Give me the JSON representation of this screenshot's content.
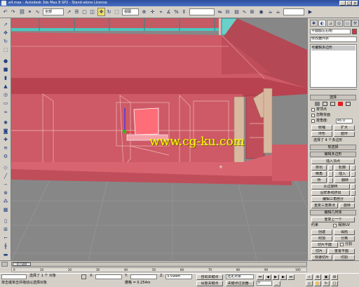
{
  "window": {
    "title": "a4.max - Autodesk 3ds Max 8 SP2 - Stand-alone License",
    "controls": [
      "_",
      "□",
      "×"
    ]
  },
  "toolbar": {
    "selection_filter": "全部",
    "reference_coord": "视图",
    "named_selection": "",
    "icons": [
      "undo-icon",
      "redo-icon",
      "select-link-icon",
      "unlink-icon",
      "bind-spacewarp-icon",
      "selection-filter",
      "select-object-icon",
      "select-by-name-icon",
      "rect-region-icon",
      "window-crossing-icon",
      "move-icon",
      "rotate-icon",
      "scale-icon",
      "ref-coord",
      "pivot-icon",
      "mirror-icon",
      "align-icon",
      "layer-icon",
      "curve-editor-icon",
      "schematic-icon",
      "material-editor-icon",
      "render-scene-icon",
      "quick-render-icon",
      "render-type"
    ]
  },
  "left_toolbar": {
    "icons": [
      "select-icon",
      "move-icon",
      "rotate-icon",
      "scale-icon",
      "sphere-icon",
      "box-icon",
      "cylinder-icon",
      "cone-icon",
      "torus-icon",
      "plane-icon",
      "teapot-icon",
      "light-icon",
      "camera-icon",
      "helper-icon",
      "spacewarp-icon",
      "systems-icon",
      "shape-icon",
      "line-icon",
      "nurbs-icon",
      "compound-icon",
      "particle-icon",
      "patch-icon",
      "door-icon",
      "window-icon",
      "stairs-icon",
      "railing-icon",
      "wall-icon"
    ]
  },
  "viewport": {
    "background": "#878787",
    "wall_color": "#cd5a66",
    "roof_color": "#c84a58",
    "wood_color": "#d7b8a0",
    "glass_color": "#5fc5c0",
    "watermark": "www.cg-ku.com"
  },
  "command_panel": {
    "object_name": "平面图左右组",
    "modifier_list": "修改器列表",
    "stack_item": "可编辑多边形",
    "rollout_selection": "选择",
    "check_by_vertex": "按顶点",
    "check_ignore_backface": "忽略背面",
    "angle_label": "按角度:",
    "angle_value": "45.0",
    "shrink_btn": "收缩",
    "grow_btn": "扩大",
    "ring_btn": "环形",
    "loop_btn": "循环",
    "selected_text": "选择了 4 个多边形",
    "rollout_soft": "软选择",
    "rollout_edit_poly": "编辑多边形",
    "insert_vertex_btn": "插入顶点",
    "extrude_btn": "挤出",
    "outline_btn": "轮廓",
    "bevel_btn": "倒角",
    "inset_btn": "插入",
    "bridge_btn": "桥",
    "flip_btn": "翻转",
    "from_edge_btn": "从边旋转",
    "along_spline_btn": "沿样条线挤出",
    "edit_tri_btn": "编辑三角剖分",
    "retriangulate_btn": "重复三角算法",
    "turn_btn": "旋转",
    "rollout_edit_geom": "编辑几何体",
    "repeat_btn": "重复上一个",
    "constraints_label": "约束",
    "preserve_uv": "保持UV",
    "create_btn": "创建",
    "collapse_btn": "塌陷",
    "attach_btn": "附加",
    "detach_btn": "分离",
    "slice_plane_btn": "切片平面",
    "split_check": "分割",
    "slice_btn": "切片",
    "reset_plane_btn": "重置平面",
    "quickslice_btn": "快速切片",
    "cut_btn": "切割",
    "msmooth_btn": "网格平滑",
    "tessellate_btn": "细化",
    "planarize_btn": "平面化",
    "xyz_btns": [
      "X",
      "Y",
      "Z"
    ],
    "view_align_btn": "视图对齐",
    "grid_align_btn": "栅格对齐",
    "relax_btn": "松弛",
    "hide_sel_btn": "隐藏选定对象",
    "unhide_all_btn": "全部取消隐藏",
    "hide_unsel_btn": "隐藏未选定对象",
    "named_sel_label": "命名选择:",
    "copy_btn": "复制",
    "paste_btn": "粘贴",
    "delete_iso": "删除孤立顶点",
    "full_interactivity": "完全交互"
  },
  "timeline": {
    "frame_slider": "0 / 100",
    "ticks": [
      "0",
      "10",
      "20",
      "30",
      "40",
      "50",
      "60",
      "70",
      "80",
      "90",
      "100"
    ]
  },
  "status": {
    "selected": "选择了 1 个 对象",
    "hint": "单击或单击并拖动以选择对象",
    "x_label": "X:",
    "x_value": "",
    "y_label": "Y:",
    "y_value": "",
    "z_label": "Z:",
    "z_value": "3.594m",
    "grid": "栅格 = 0.254m",
    "autokey": "自动关键点",
    "selected_set": "选定对象",
    "set_key": "设置关键点",
    "key_filters": "关键点过滤器...",
    "frame": "0"
  }
}
